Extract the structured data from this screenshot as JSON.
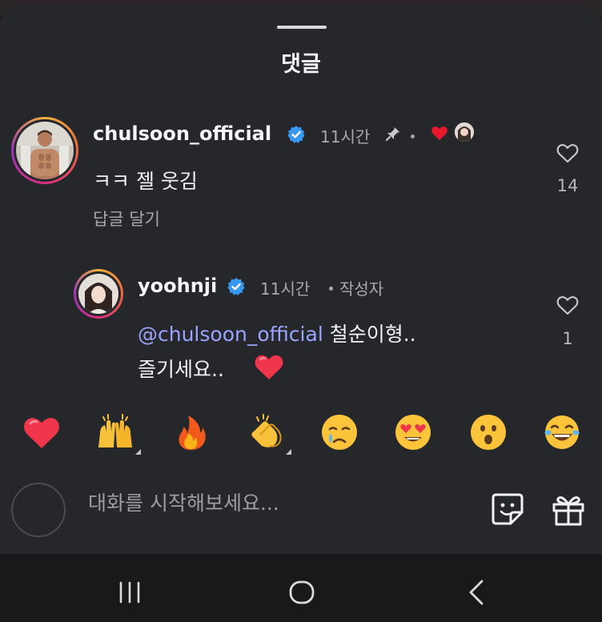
{
  "sheet": {
    "title": "댓글"
  },
  "comment": {
    "username": "chulsoon_official",
    "time": "11시간",
    "text": "ㅋㅋ 젤 웃김",
    "reply_label": "답글 달기",
    "likes": "14"
  },
  "reply": {
    "username": "yoohnji",
    "time": "11시간",
    "author_badge": "작성자",
    "mention": "@chulsoon_official",
    "text_line1": "철순이형..",
    "text_line2": "즐기세요..",
    "likes": "1"
  },
  "emoji_bar": [
    "red-heart",
    "raising-hands",
    "fire",
    "clapping-hands",
    "crying-face",
    "heart-eyes-face",
    "surprised-face",
    "tears-of-joy-face"
  ],
  "composer": {
    "placeholder": "대화를 시작해보세요..."
  },
  "colors": {
    "background": "#26272b",
    "verified": "#3897f0",
    "mention": "#9aa4ff",
    "heart": "#f0364a"
  }
}
